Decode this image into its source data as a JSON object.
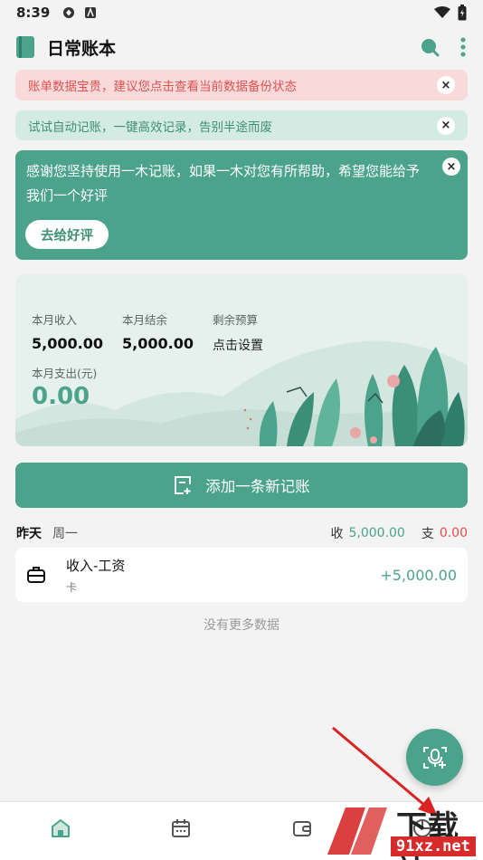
{
  "status_bar": {
    "time": "8:39"
  },
  "app_bar": {
    "title": "日常账本"
  },
  "notices": {
    "backup": "账单数据宝贵，建议您点击查看当前数据备份状态",
    "auto": "试试自动记账，一键高效记录，告别半途而废",
    "close_glyph": "×"
  },
  "rate_card": {
    "text": "感谢您坚持使用一木记账，如果一木对您有所帮助，希望您能给予我们一个好评",
    "button": "去给好评"
  },
  "summary": {
    "income_label": "本月收入",
    "income_value": "5,000.00",
    "balance_label": "本月结余",
    "balance_value": "5,000.00",
    "budget_label": "剩余预算",
    "budget_link": "点击设置",
    "expense_label": "本月支出(元)",
    "expense_value": "0.00"
  },
  "add_button": {
    "label": "添加一条新记账"
  },
  "day_group": {
    "day": "昨天",
    "weekday": "周一",
    "income_label": "收",
    "income_value": "5,000.00",
    "expense_label": "支",
    "expense_value": "0.00"
  },
  "transactions": [
    {
      "title": "收入-工资",
      "account": "卡",
      "amount": "+5,000.00",
      "icon": "briefcase-icon"
    }
  ],
  "no_more": "没有更多数据",
  "bottom_nav": {
    "items": [
      "home-icon",
      "calendar-icon",
      "wallet-icon",
      "chart-icon"
    ]
  },
  "watermark": {
    "big": "下载站",
    "small": "91xz.net"
  },
  "colors": {
    "accent": "#4aa38a",
    "danger": "#e84b4b",
    "notice_red_bg": "#f9dada",
    "notice_green_bg": "#d4ebe3"
  }
}
